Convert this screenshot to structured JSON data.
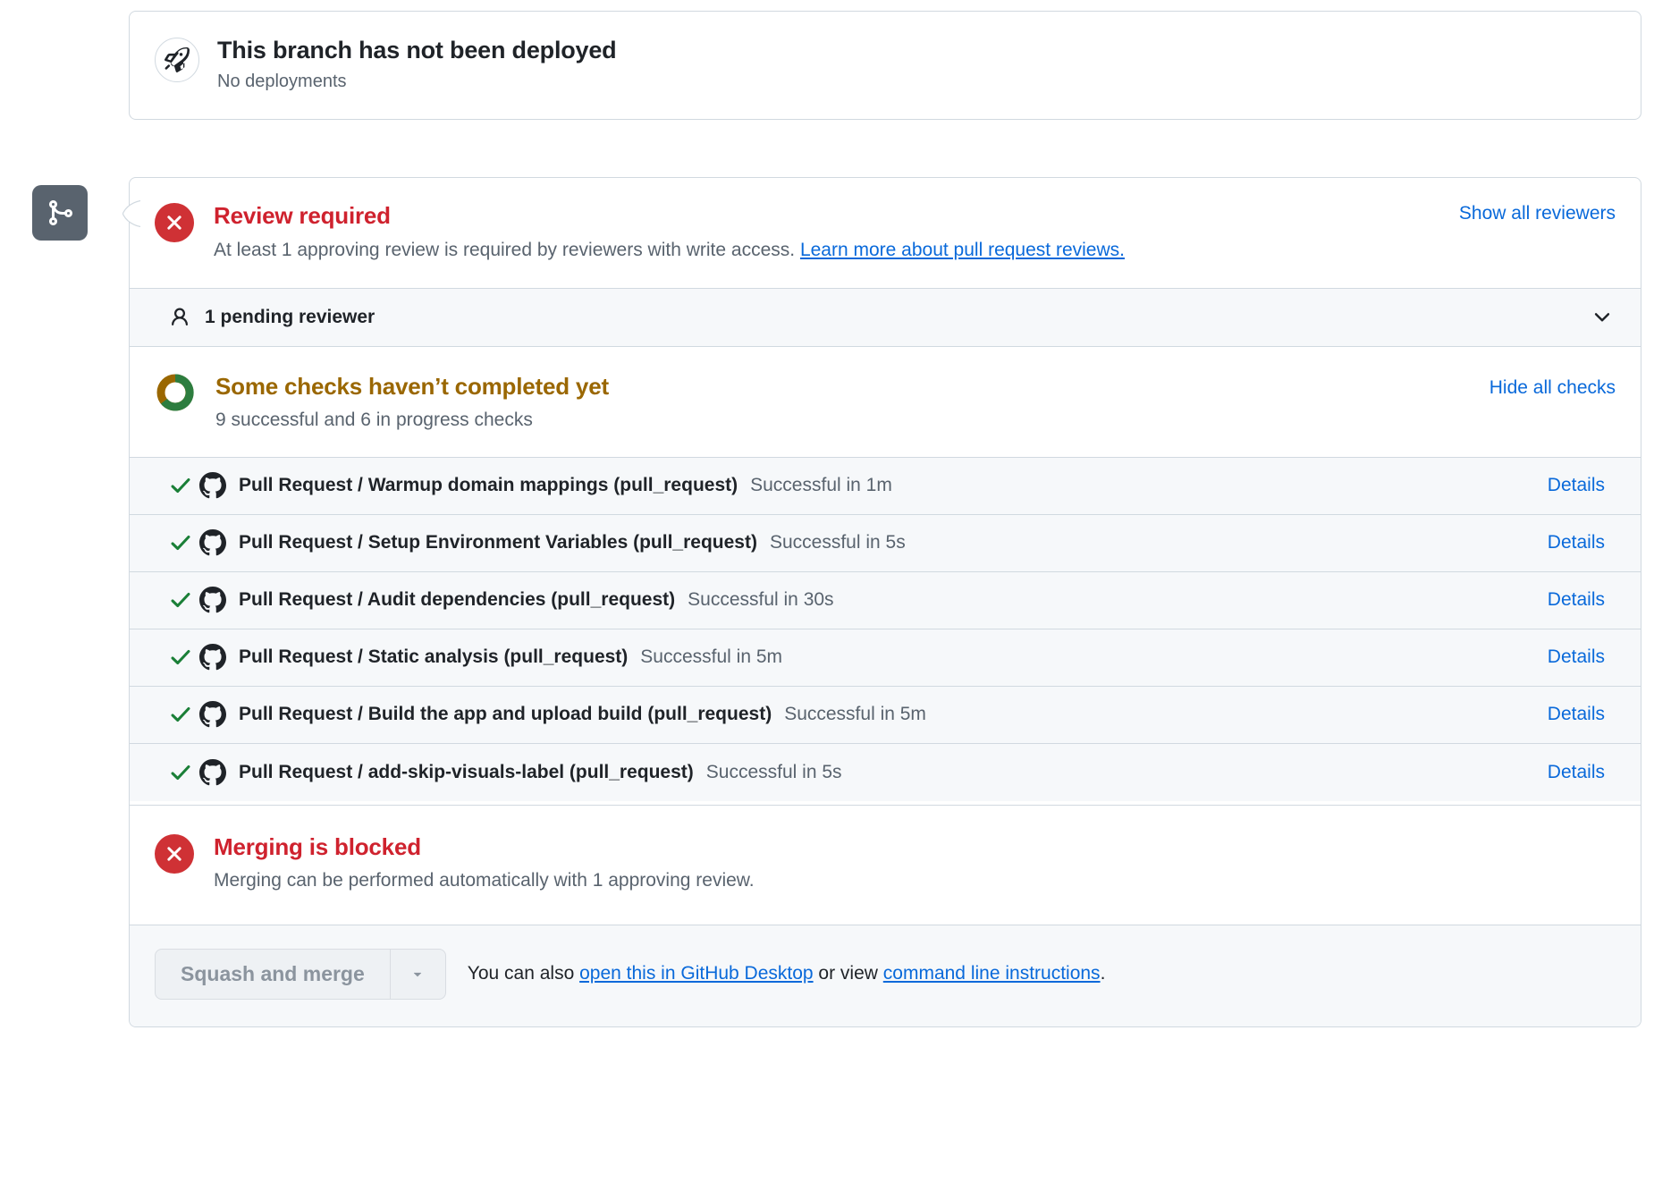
{
  "deployments": {
    "icon": "rocket-icon",
    "title": "This branch has not been deployed",
    "subtitle": "No deployments"
  },
  "branch_badge": {
    "icon": "git-merge-icon"
  },
  "review": {
    "icon": "x-circle-icon",
    "title": "Review required",
    "description_prefix": "At least 1 approving review is required by reviewers with write access. ",
    "description_link": "Learn more about pull request reviews.",
    "show_all_reviewers": "Show all reviewers"
  },
  "pending_reviewers": {
    "icon": "person-icon",
    "label": "1 pending reviewer",
    "chevron": "chevron-down-icon"
  },
  "checks": {
    "icon": "progress-donut-icon",
    "title": "Some checks haven’t completed yet",
    "summary": "9 successful and 6 in progress checks",
    "toggle_label": "Hide all checks",
    "details_label": "Details",
    "rows": [
      {
        "status_icon": "check-icon",
        "app_icon": "github-mark-icon",
        "name": "Pull Request / Warmup domain mappings (pull_request)",
        "status": "Successful in 1m",
        "details": "Details"
      },
      {
        "status_icon": "check-icon",
        "app_icon": "github-mark-icon",
        "name": "Pull Request / Setup Environment Variables (pull_request)",
        "status": "Successful in 5s",
        "details": "Details"
      },
      {
        "status_icon": "check-icon",
        "app_icon": "github-mark-icon",
        "name": "Pull Request / Audit dependencies (pull_request)",
        "status": "Successful in 30s",
        "details": "Details"
      },
      {
        "status_icon": "check-icon",
        "app_icon": "github-mark-icon",
        "name": "Pull Request / Static analysis (pull_request)",
        "status": "Successful in 5m",
        "details": "Details"
      },
      {
        "status_icon": "check-icon",
        "app_icon": "github-mark-icon",
        "name": "Pull Request / Build the app and upload build (pull_request)",
        "status": "Successful in 5m",
        "details": "Details"
      },
      {
        "status_icon": "check-icon",
        "app_icon": "github-mark-icon",
        "name": "Pull Request / add-skip-visuals-label (pull_request)",
        "status": "Successful in 5s",
        "details": "Details"
      }
    ]
  },
  "merging": {
    "icon": "x-circle-icon",
    "title": "Merging is blocked",
    "description": "Merging can be performed automatically with 1 approving review."
  },
  "footer": {
    "merge_button": "Squash and merge",
    "caret": "caret-down-icon",
    "text_before": "You can also ",
    "link_desktop": "open this in GitHub Desktop",
    "text_middle": " or view ",
    "link_cli": "command line instructions",
    "text_after": "."
  },
  "colors": {
    "danger": "#cf222e",
    "danger_fill": "#cf3135",
    "pending": "#9a6700",
    "success": "#1a7f37",
    "link": "#0969da",
    "muted": "#59636e",
    "border": "#d1d9e0",
    "subtle_bg": "#f6f8fa",
    "badge_bg": "#59636e"
  }
}
